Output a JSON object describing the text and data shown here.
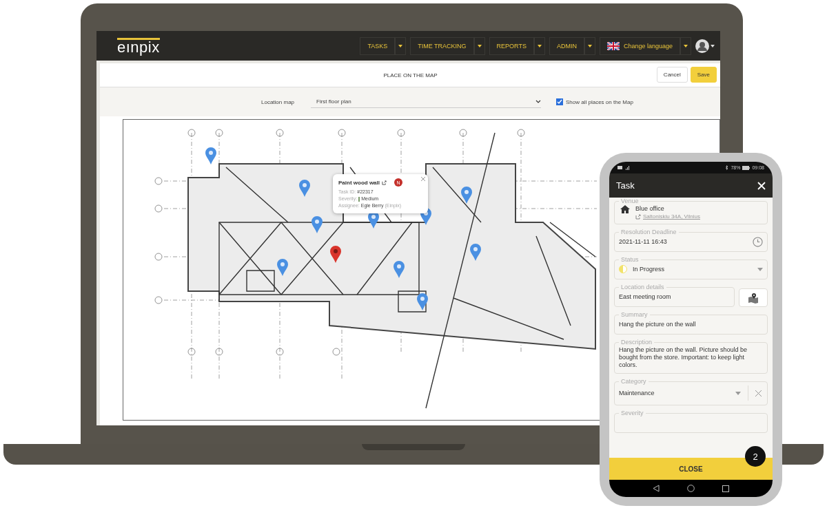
{
  "header": {
    "logo": "eınpix",
    "nav": [
      {
        "label": "TASKS"
      },
      {
        "label": "TIME TRACKING"
      },
      {
        "label": "REPORTS"
      },
      {
        "label": "ADMIN"
      }
    ],
    "language": "Change language"
  },
  "page": {
    "title": "PLACE ON THE MAP",
    "buttons": [
      {
        "label": "Cancel",
        "kind": "secondary"
      },
      {
        "label": "Save",
        "kind": "primary"
      }
    ]
  },
  "filter": {
    "label": "Location map",
    "value": "First floor plan",
    "show_all": {
      "label": "Show all places on the Map",
      "checked": true
    }
  },
  "map": {
    "pins": [
      {
        "selected": false
      },
      {
        "selected": false
      },
      {
        "selected": false
      },
      {
        "selected": false
      },
      {
        "selected": false
      },
      {
        "selected": false
      },
      {
        "selected": true
      },
      {
        "selected": false
      },
      {
        "selected": false
      },
      {
        "selected": false
      },
      {
        "selected": false
      }
    ],
    "popup": {
      "title": "Paint wood wall",
      "badge": "N",
      "fields": [
        {
          "label": "Task ID:",
          "value": "#22317",
          "kind": "text"
        },
        {
          "label": "Severity:",
          "value": "Medium",
          "kind": "severity"
        },
        {
          "label": "Assignee:",
          "value": "Egle Berry",
          "note": "(Einpix)",
          "kind": "text"
        }
      ]
    }
  },
  "phone": {
    "battery": "78%",
    "time": "09:08",
    "title": "Task",
    "fields": [
      {
        "kind": "venue",
        "label": "Venue",
        "value": "Blue office",
        "link": "Saltoniskiu 34A, Vilnius"
      },
      {
        "kind": "date",
        "label": "Resolution Deadline",
        "value": "2021-11-11 16:43"
      },
      {
        "kind": "status",
        "label": "Status",
        "value": "In Progress"
      },
      {
        "kind": "location",
        "label": "Location details",
        "value": "East meeting room"
      },
      {
        "kind": "text",
        "label": "Summary",
        "value": "Hang the picture on the wall"
      },
      {
        "kind": "text",
        "label": "Description",
        "value": "Hang the picture on the wall. Picture should be bought from the store. Important: to keep light colors."
      },
      {
        "kind": "select",
        "label": "Category",
        "value": "Maintenance"
      },
      {
        "kind": "empty",
        "label": "Severity"
      }
    ],
    "close": "CLOSE",
    "chat_badge": "2"
  }
}
